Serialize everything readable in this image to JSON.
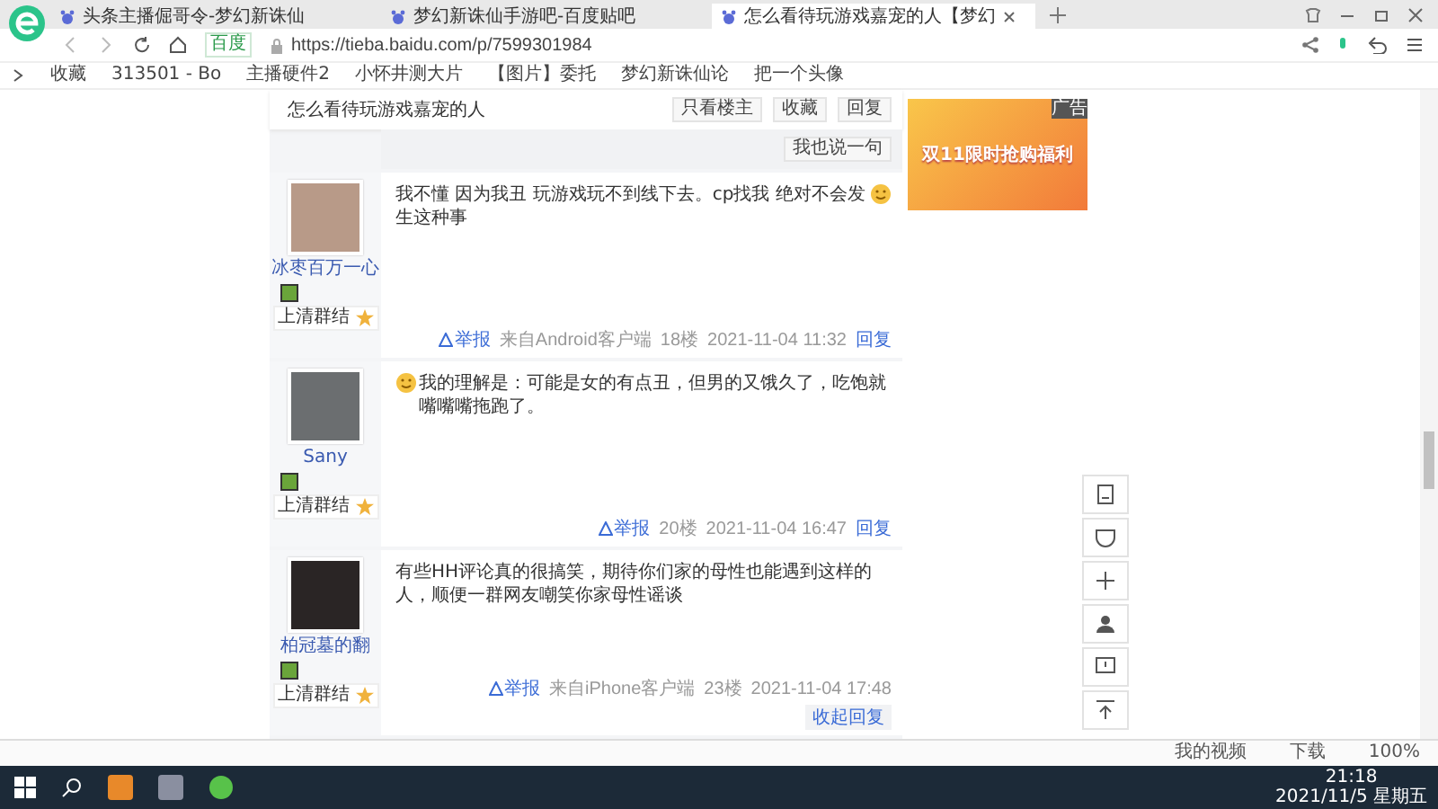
{
  "browser": {
    "tabs": [
      {
        "title": "头条主播倔哥令-梦幻新诛仙",
        "selected": false
      },
      {
        "title": "梦幻新诛仙手游吧-百度贴吧",
        "selected": false
      },
      {
        "title": "怎么看待玩游戏嘉宠的人【梦幻",
        "selected": true
      }
    ],
    "address": {
      "badge": "百度",
      "url": "https://tieba.baidu.com/p/7599301984"
    },
    "bookmarks": [
      "收藏",
      "313501 - Bo",
      "主播硬件2",
      "小怀井测大片",
      "【图片】委托",
      "梦幻新诛仙论",
      "把一个头像"
    ]
  },
  "thread": {
    "title": "怎么看待玩游戏嘉宠的人",
    "buttons": [
      "只看楼主",
      "收藏",
      "回复"
    ],
    "reply_button": "我也说一句",
    "posts": [
      {
        "author": "冰枣百万一心",
        "level_title": "上清群结",
        "trailing_smiley": true,
        "text": "我不懂 因为我丑 玩游戏玩不到线下去。cp找我 绝对不会发生这种事",
        "report": "举报",
        "client": "来自Android客户端",
        "floor": "18楼",
        "time": "2021-11-04 11:32",
        "reply": "回复"
      },
      {
        "author": "Sany",
        "level_title": "上清群结",
        "leading_smiley": true,
        "text": "我的理解是：可能是女的有点丑，但男的又饿久了，吃饱就嘴嘴嘴拖跑了。",
        "report": "举报",
        "floor": "20楼",
        "time": "2021-11-04 16:47",
        "reply": "回复"
      },
      {
        "author": "柏冠墓的翻",
        "level_title": "上清群结",
        "text": "有些HH评论真的很搞笑，期待你们家的母性也能遇到这样的人，顺便一群网友嘲笑你家母性谣谈",
        "report": "举报",
        "client": "来自iPhone客户端",
        "floor": "23楼",
        "time": "2021-11-04 17:48",
        "reply": "收起回复"
      }
    ]
  },
  "ad": {
    "label": "广告",
    "headline": "双11限时抢购福利"
  },
  "status_bar": {
    "items": [
      "我的视频",
      "下载",
      "100%"
    ]
  },
  "taskbar": {
    "time": "21:18",
    "date": "2021/11/5 星期五"
  }
}
